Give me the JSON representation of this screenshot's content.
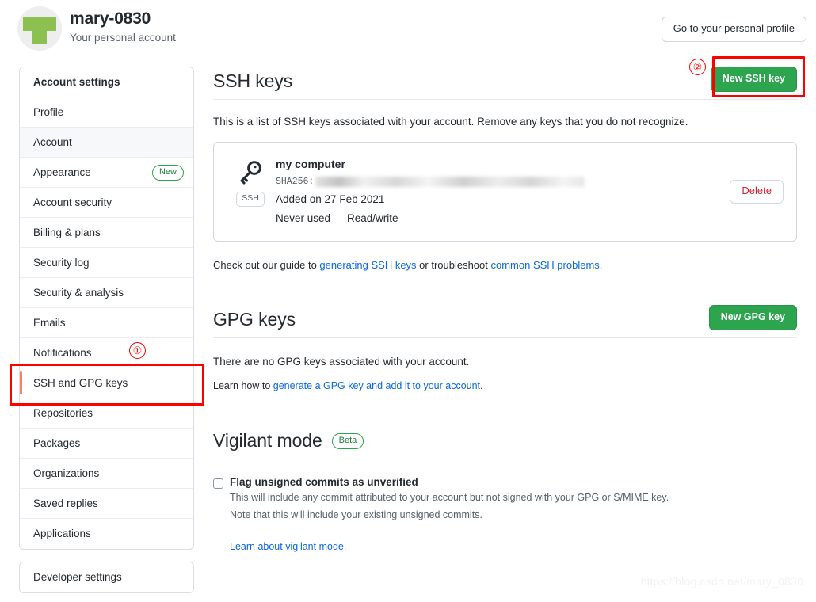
{
  "header": {
    "account_name": "mary-0830",
    "account_subtitle": "Your personal account",
    "profile_button": "Go to your personal profile",
    "avatar_color": "#8cc152"
  },
  "sidebar": {
    "items": [
      {
        "label": "Account settings",
        "state": "heading"
      },
      {
        "label": "Profile",
        "state": "normal"
      },
      {
        "label": "Account",
        "state": "current"
      },
      {
        "label": "Appearance",
        "state": "normal",
        "badge": "New"
      },
      {
        "label": "Account security",
        "state": "normal"
      },
      {
        "label": "Billing & plans",
        "state": "normal"
      },
      {
        "label": "Security log",
        "state": "normal"
      },
      {
        "label": "Security & analysis",
        "state": "normal"
      },
      {
        "label": "Emails",
        "state": "normal"
      },
      {
        "label": "Notifications",
        "state": "normal"
      },
      {
        "label": "SSH and GPG keys",
        "state": "selected"
      },
      {
        "label": "Repositories",
        "state": "normal"
      },
      {
        "label": "Packages",
        "state": "normal"
      },
      {
        "label": "Organizations",
        "state": "normal"
      },
      {
        "label": "Saved replies",
        "state": "normal"
      },
      {
        "label": "Applications",
        "state": "normal"
      }
    ],
    "developer_settings": "Developer settings"
  },
  "ssh_section": {
    "title": "SSH keys",
    "new_key_button": "New SSH key",
    "description": "This is a list of SSH keys associated with your account. Remove any keys that you do not recognize.",
    "key": {
      "icon": "key-icon",
      "type_tag": "SSH",
      "title": "my computer",
      "fingerprint_label": "SHA256:",
      "fingerprint_value": "",
      "added": "Added on 27 Feb 2021",
      "usage": "Never used — Read/write",
      "delete_button": "Delete"
    },
    "help_prefix": "Check out our guide to ",
    "help_link_1": "generating SSH keys",
    "help_middle": " or troubleshoot ",
    "help_link_2": "common SSH problems",
    "help_suffix": "."
  },
  "gpg_section": {
    "title": "GPG keys",
    "new_key_button": "New GPG key",
    "empty_text": "There are no GPG keys associated with your account.",
    "learn_prefix": "Learn how to ",
    "learn_link": "generate a GPG key and add it to your account",
    "learn_suffix": "."
  },
  "vigilant_section": {
    "title": "Vigilant mode",
    "badge": "Beta",
    "checkbox_label": "Flag unsigned commits as unverified",
    "checkbox_checked": false,
    "note_line_1": "This will include any commit attributed to your account but not signed with your GPG or S/MIME key.",
    "note_line_2": "Note that this will include your existing unsigned commits.",
    "learn_link": "Learn about vigilant mode."
  },
  "annotations": {
    "marker_1": "①",
    "marker_2": "②",
    "highlight_color": "#fe0000"
  },
  "watermark": "https://blog.csdn.net/mary_0830",
  "colors": {
    "green_button": "#2da44e",
    "link_blue": "#0969da",
    "delete_red": "#cf222e",
    "active_bar": "#f78166"
  }
}
